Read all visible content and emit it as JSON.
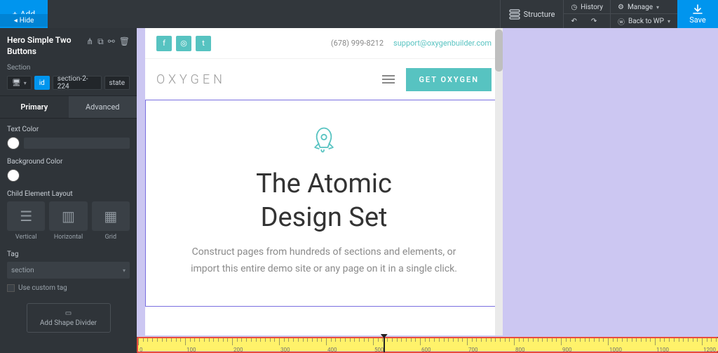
{
  "topbar": {
    "add": "Add",
    "hide": "Hide",
    "structure": "Structure",
    "history": "History",
    "manage": "Manage",
    "back_to_wp": "Back to WP",
    "save": "Save"
  },
  "selection": {
    "title": "Hero Simple Two Buttons",
    "type_label": "Section",
    "id_chip": "id",
    "id_value": "section-2-224",
    "state": "state"
  },
  "tabs": {
    "primary": "Primary",
    "advanced": "Advanced"
  },
  "panel": {
    "text_color_label": "Text Color",
    "bg_color_label": "Background Color",
    "child_layout_label": "Child Element Layout",
    "layout_vertical": "Vertical",
    "layout_horizontal": "Horizontal",
    "layout_grid": "Grid",
    "tag_label": "Tag",
    "tag_value": "section",
    "use_custom_tag": "Use custom tag",
    "shape_btn": "Add Shape Divider"
  },
  "site": {
    "phone": "(678) 999-8212",
    "email": "support@oxygenbuilder.com",
    "logo": "OXYGEN",
    "cta": "GET OXYGEN",
    "hero_title_l1": "The Atomic",
    "hero_title_l2": "Design Set",
    "hero_body": "Construct pages from hundreds of sections and elements, or import this entire demo site or any page on it in a single click."
  },
  "ruler": {
    "marks": [
      0,
      100,
      200,
      300,
      400,
      500,
      600,
      700,
      800,
      900,
      1000,
      1100,
      1200
    ],
    "handle_at": 522
  },
  "colors": {
    "white": "#ffffff"
  }
}
